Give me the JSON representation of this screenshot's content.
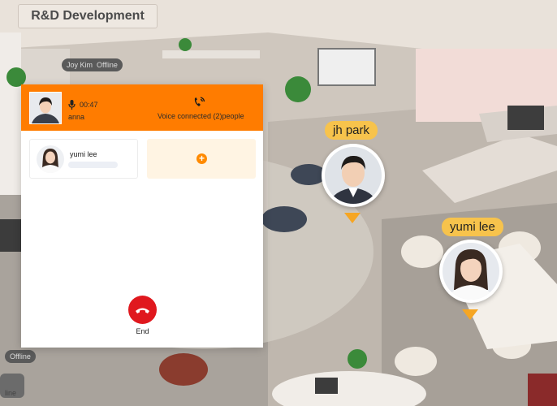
{
  "room": {
    "title": "R&D Development"
  },
  "background": {
    "offline_tags": [
      {
        "name": "Joy Kim",
        "status": "Offline"
      },
      {
        "status": "Offline"
      },
      {
        "status": "Offline"
      },
      {
        "status": "line"
      }
    ]
  },
  "map_users": [
    {
      "name": "jh park"
    },
    {
      "name": "yumi lee"
    }
  ],
  "call": {
    "self_name": "anna",
    "timer": "00:47",
    "voice_status": "Voice connected (2)people",
    "members": [
      {
        "name": "yumi lee"
      }
    ],
    "add_label": "+",
    "end_label": "End"
  },
  "colors": {
    "header": "#ff7c00",
    "end_button": "#e0181e",
    "tag": "#f7c34c",
    "pointer": "#f6a623"
  },
  "icons": [
    "microphone-icon",
    "voice-call-icon",
    "plus-icon",
    "hang-up-icon"
  ]
}
